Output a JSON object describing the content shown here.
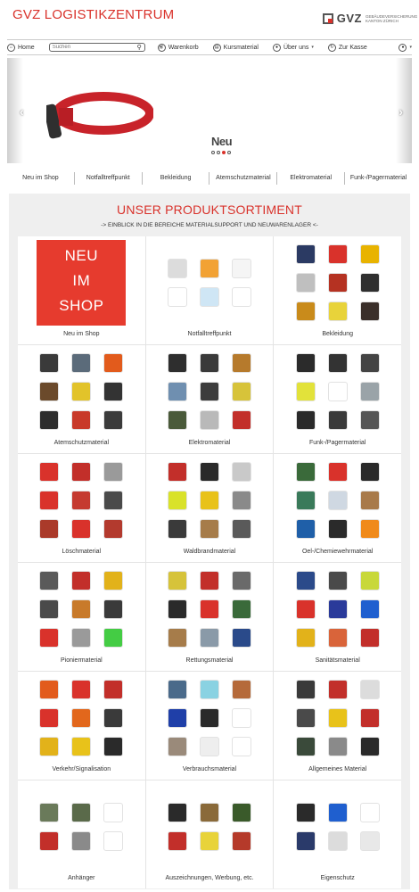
{
  "header": {
    "brand": "GVZ LOGISTIKZENTRUM",
    "gvz_word": "GVZ",
    "gvz_sub": "GEBÄUDEVERSICHERUNG KANTON ZÜRICH"
  },
  "nav": {
    "home": "Home",
    "search_placeholder": "Suchen",
    "cart": "Warenkorb",
    "course_material": "Kursmaterial",
    "about": "Über uns",
    "checkout": "Zur Kasse"
  },
  "banner": {
    "title": "Neu",
    "slide_count": 4,
    "active_slide": 3,
    "accent": "#d9322b"
  },
  "category_tabs": [
    "Neu im Shop",
    "Notfalltreffpunkt",
    "Bekleidung",
    "Atemschutzmaterial",
    "Elektromaterial",
    "Funk-/Pagermaterial"
  ],
  "section": {
    "title": "UNSER PRODUKTSORTIMENT",
    "subtitle": "-> EINBLICK IN DIE BEREICHE MATERIALSUPPORT UND NEUWARENLAGER <-"
  },
  "neu_tile": [
    "NEU",
    "IM",
    "SHOP"
  ],
  "products": [
    {
      "label": "Neu im Shop",
      "colors": []
    },
    {
      "label": "Notfalltreffpunkt",
      "colors": [
        "#dcdcdc",
        "#f2a234",
        "#f5f5f5",
        "#ffffff",
        "#cfe6f5",
        "#ffffff"
      ]
    },
    {
      "label": "Bekleidung",
      "colors": [
        "#2b3a63",
        "#d9322b",
        "#e8b300",
        "#bfbfbf",
        "#b53222",
        "#2f2f2f",
        "#c98b1b",
        "#e8d33a",
        "#3a2f2a"
      ]
    },
    {
      "label": "Atemschutzmaterial",
      "colors": [
        "#3a3a3a",
        "#5b6b7a",
        "#e25b1c",
        "#6b4a2b",
        "#e2c32a",
        "#333333",
        "#2d2d2d",
        "#c83a2a",
        "#3b3b3b"
      ]
    },
    {
      "label": "Elektromaterial",
      "colors": [
        "#2e2e2e",
        "#3a3a3a",
        "#b67a2c",
        "#6f8fb0",
        "#3c3c3c",
        "#d7c33a",
        "#4a5a3a",
        "#b9b9b9",
        "#c22f2a"
      ]
    },
    {
      "label": "Funk-/Pagermaterial",
      "colors": [
        "#2b2b2b",
        "#333333",
        "#444444",
        "#e2e23a",
        "#ffffff",
        "#9aa3a8",
        "#2a2a2a",
        "#3a3a3a",
        "#555555"
      ]
    },
    {
      "label": "Löschmaterial",
      "colors": [
        "#d9322b",
        "#c22f2a",
        "#9a9a9a",
        "#d9322b",
        "#c53a30",
        "#4a4a4a",
        "#aa3a2a",
        "#d9322b",
        "#b33a2e"
      ]
    },
    {
      "label": "Waldbrandmaterial",
      "colors": [
        "#c22f2a",
        "#2a2a2a",
        "#c9c9c9",
        "#d9e22a",
        "#e8c21a",
        "#8a8a8a",
        "#3a3a3a",
        "#a67c4a",
        "#5a5a5a"
      ]
    },
    {
      "label": "Oel-/Chemiewehrmaterial",
      "colors": [
        "#3a6a3a",
        "#d9322b",
        "#2a2a2a",
        "#3a7a5a",
        "#cfd8e2",
        "#a87a4a",
        "#1f5fa8",
        "#2a2a2a",
        "#f08a1a"
      ]
    },
    {
      "label": "Pioniermaterial",
      "colors": [
        "#5a5a5a",
        "#c22f2a",
        "#e2b21a",
        "#4a4a4a",
        "#c87a2a",
        "#3a3a3a",
        "#d9322b",
        "#9a9a9a",
        "#44cc44"
      ]
    },
    {
      "label": "Rettungsmaterial",
      "colors": [
        "#d6c33a",
        "#c22f2a",
        "#6a6a6a",
        "#2a2a2a",
        "#d9322b",
        "#3a6a3a",
        "#a67c4a",
        "#8a9aa8",
        "#2a4a8a"
      ]
    },
    {
      "label": "Sanitätsmaterial",
      "colors": [
        "#2b4a8a",
        "#4a4a4a",
        "#c8d83a",
        "#d9322b",
        "#2a3a9a",
        "#1f5fcf",
        "#e2b21a",
        "#d9643a",
        "#c22f2a"
      ]
    },
    {
      "label": "Verkehr/Signalisation",
      "colors": [
        "#e25b1c",
        "#d9322b",
        "#c22f2a",
        "#d9322b",
        "#e2671c",
        "#3a3a3a",
        "#e2b21a",
        "#e8c21a",
        "#2a2a2a"
      ]
    },
    {
      "label": "Verbrauchsmaterial",
      "colors": [
        "#4a6a8a",
        "#8ad2e2",
        "#b56a3a",
        "#1f3fa8",
        "#2a2a2a",
        "#ffffff",
        "#9a8a7a",
        "#eeeeee",
        "#ffffff"
      ]
    },
    {
      "label": "Allgemeines Material",
      "colors": [
        "#3a3a3a",
        "#c22f2a",
        "#dcdcdc",
        "#4a4a4a",
        "#e8c21a",
        "#c22f2a",
        "#3a4a3a",
        "#8a8a8a",
        "#2a2a2a"
      ]
    },
    {
      "label": "Anhänger",
      "colors": [
        "#6a7a5a",
        "#5a6a4a",
        "#ffffff",
        "#c22f2a",
        "#8a8a8a",
        "#ffffff"
      ]
    },
    {
      "label": "Auszeichnungen, Werbung, etc.",
      "colors": [
        "#2a2a2a",
        "#8a6a3a",
        "#3a5a2a",
        "#c22f2a",
        "#e8d33a",
        "#b53a2a"
      ]
    },
    {
      "label": "Eigenschutz",
      "colors": [
        "#2a2a2a",
        "#1f5fcf",
        "#ffffff",
        "#2a3a6a",
        "#dcdcdc",
        "#e8e8e8"
      ]
    }
  ]
}
